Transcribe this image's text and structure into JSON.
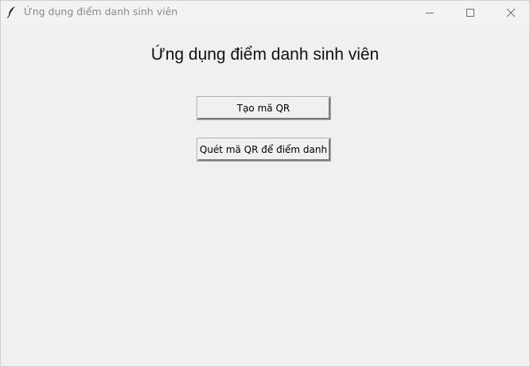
{
  "window": {
    "title": "Ứng dụng điểm danh sinh viên",
    "icon": "feather-icon",
    "controls": [
      "minimize-icon",
      "maximize-icon",
      "close-icon"
    ]
  },
  "main": {
    "heading": "Ứng dụng điểm danh sinh viên",
    "buttons": {
      "create_qr": "Tạo mã QR",
      "scan_qr": "Quét mã QR để điểm danh"
    }
  },
  "colors": {
    "background": "#f0f0f0",
    "titlebar": "#f3f3f3",
    "title_text": "#8a8a8a"
  }
}
